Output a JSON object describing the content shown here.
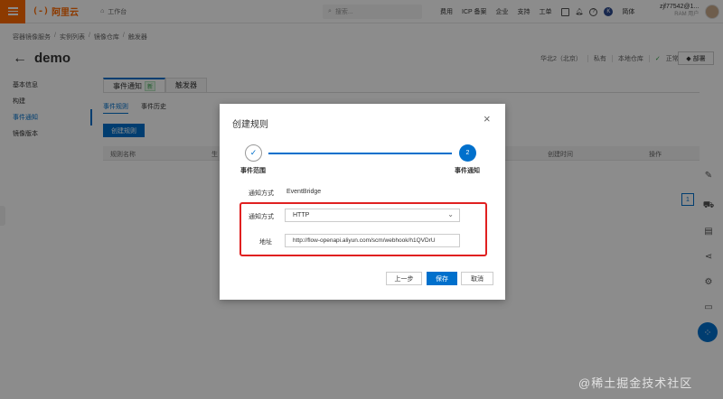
{
  "topbar": {
    "logo_mark": "(-)",
    "logo_text": "阿里云",
    "workbench": "工作台",
    "search_placeholder": "搜索...",
    "links": [
      "费用",
      "ICP 备案",
      "企业",
      "支持",
      "工单"
    ],
    "lang": "简体",
    "user_name": "zjf77542@1...",
    "user_sub": "RAM 用户"
  },
  "breadcrumb": [
    "容器镜像服务",
    "实例列表",
    "镜像仓库",
    "触发器"
  ],
  "header": {
    "title": "demo",
    "region": "华北2（北京）",
    "visibility": "私有",
    "type": "本地仓库",
    "status": "正常",
    "deploy_label": "部署"
  },
  "sidebar": {
    "items": [
      {
        "label": "基本信息",
        "active": false
      },
      {
        "label": "构建",
        "active": false
      },
      {
        "label": "事件通知",
        "active": true
      },
      {
        "label": "镜像版本",
        "active": false
      }
    ]
  },
  "main": {
    "tabs": [
      {
        "label": "事件通知",
        "badge": "新",
        "active": true
      },
      {
        "label": "触发器",
        "badge": "",
        "active": false
      }
    ],
    "subtabs": [
      "事件规则",
      "事件历史"
    ],
    "create_label": "创建规则",
    "columns": [
      "规则名称",
      "生",
      "创建时间",
      "操作"
    ],
    "page": "1"
  },
  "modal": {
    "title": "创建规则",
    "close": "×",
    "step1_icon": "✓",
    "step1_label": "事件范围",
    "step2_number": "2",
    "step2_label": "事件通知",
    "notify_channel_label": "通知方式",
    "notify_channel_value": "EventBridge",
    "notify_method_label": "通知方式",
    "notify_method_value": "HTTP",
    "address_label": "地址",
    "address_value": "http://flow-openapi.aliyun.com/scm/webhook/h1QVDrU",
    "prev_label": "上一步",
    "save_label": "保存",
    "cancel_label": "取消"
  },
  "watermark": "@稀土掘金技术社区",
  "colors": {
    "brand": "#ff6a00",
    "primary": "#0070cc",
    "highlight": "#e02020",
    "success": "#2e9e44"
  }
}
